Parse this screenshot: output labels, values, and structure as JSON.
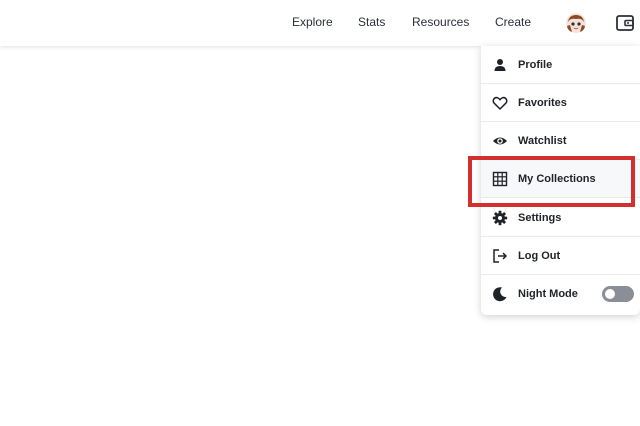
{
  "nav": {
    "explore": "Explore",
    "stats": "Stats",
    "resources": "Resources",
    "create": "Create"
  },
  "account_menu": {
    "items": [
      {
        "label": "Profile",
        "icon": "person-icon"
      },
      {
        "label": "Favorites",
        "icon": "heart-icon"
      },
      {
        "label": "Watchlist",
        "icon": "eye-icon"
      },
      {
        "label": "My Collections",
        "icon": "grid-icon"
      },
      {
        "label": "Settings",
        "icon": "gear-icon"
      },
      {
        "label": "Log Out",
        "icon": "logout-icon"
      },
      {
        "label": "Night Mode",
        "icon": "moon-icon"
      }
    ],
    "night_mode_enabled": false
  },
  "colors": {
    "highlight": "#d32f2f",
    "toggle_off": "#8a8f97",
    "text": "#1f2229"
  }
}
